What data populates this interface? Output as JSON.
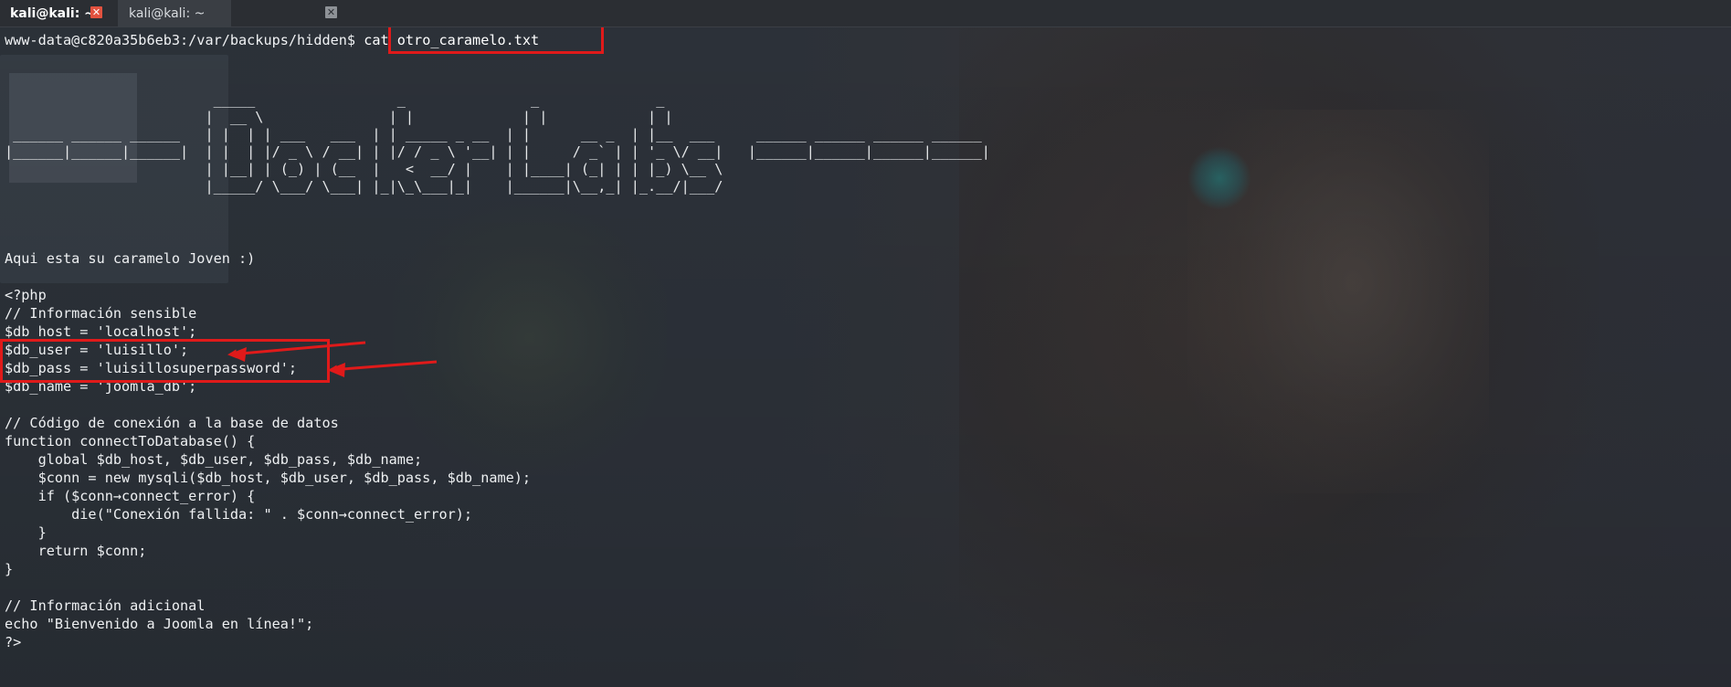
{
  "tabs": [
    {
      "label": "kali@kali: ~",
      "close_glyph": "✕"
    },
    {
      "label": "kali@kali: ~",
      "close_glyph": "✕"
    }
  ],
  "prompt": {
    "text": "www-data@c820a35b6eb3:/var/backups/hidden$ ",
    "command": "cat otro_caramelo.txt"
  },
  "ascii_banner": [
    "                         _____                 _               _              _                                  ",
    "                        |  __ \\               | |             | |            | |                                 ",
    " ______ ______ ______   | |  | | ___   ___  | | _____ _ __  | |      __ _  | |__  ___     ______ ______ ______ ______ ",
    "|______|______|______|  | |  | |/ _ \\ / __| | |/ / _ \\ '__| | |     / _` | | '_ \\/ __|   |______|______|______|______|",
    "                        | |__| | (_) | (__  |   <  __/ |    | |____| (_| | | |_) \\__ \\                              ",
    "                        |_____/ \\___/ \\___| |_|\\_\\___|_|    |______|\\__,_| |_.__/|___/                              "
  ],
  "output_lines": [
    "Aqui esta su caramelo Joven :)",
    "",
    "<?php",
    "// Información sensible",
    "$db_host = 'localhost';",
    "$db_user = 'luisillo';",
    "$db_pass = 'luisillosuperpassword';",
    "$db_name = 'joomla_db';",
    "",
    "// Código de conexión a la base de datos",
    "function connectToDatabase() {",
    "    global $db_host, $db_user, $db_pass, $db_name;",
    "    $conn = new mysqli($db_host, $db_user, $db_pass, $db_name);",
    "    if ($conn→connect_error) {",
    "        die(\"Conexión fallida: \" . $conn→connect_error);",
    "    }",
    "    return $conn;",
    "}",
    "",
    "// Información adicional",
    "echo \"Bienvenido a Joomla en línea!\";",
    "?>"
  ],
  "colors": {
    "annotation": "#e01a1a",
    "text": "#eef0f2",
    "active_close": "#e2523f"
  }
}
